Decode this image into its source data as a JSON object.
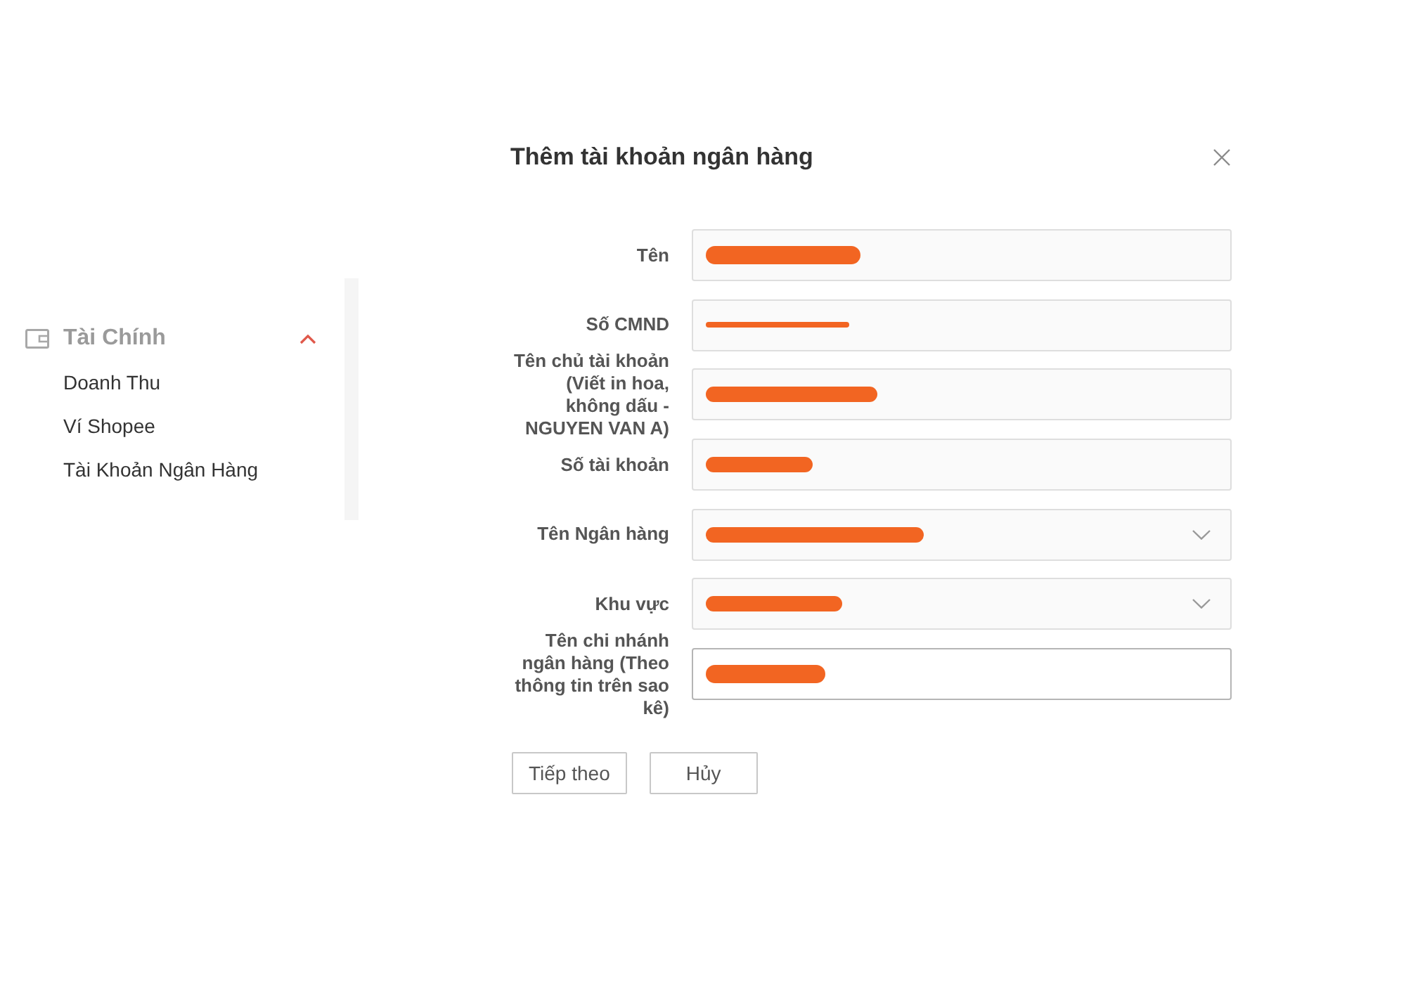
{
  "sidebar": {
    "group": {
      "label": "Tài Chính",
      "expanded": true,
      "items": [
        {
          "label": "Doanh Thu",
          "selected": false
        },
        {
          "label": "Ví Shopee",
          "selected": false
        },
        {
          "label": "Tài Khoản Ngân Hàng",
          "selected": false
        }
      ]
    }
  },
  "dialog": {
    "title": "Thêm tài khoản ngân hàng",
    "fields": [
      {
        "label": "Tên",
        "kind": "text",
        "redacted": true,
        "focused": false
      },
      {
        "label": "Số CMND",
        "kind": "text",
        "redacted": true,
        "focused": false
      },
      {
        "label": "Tên chủ tài khoản (Viết in hoa, không dấu - NGUYEN VAN A)",
        "kind": "text",
        "redacted": true,
        "focused": false
      },
      {
        "label": "Số tài khoản",
        "kind": "text",
        "redacted": true,
        "focused": false
      },
      {
        "label": "Tên Ngân hàng",
        "kind": "select",
        "redacted": true,
        "focused": false
      },
      {
        "label": "Khu vực",
        "kind": "select",
        "redacted": true,
        "focused": false
      },
      {
        "label": "Tên chi nhánh ngân hàng (Theo thông tin trên sao kê)",
        "kind": "text",
        "redacted": true,
        "focused": true
      }
    ],
    "buttons": [
      "Tiếp theo",
      "Hủy"
    ]
  }
}
